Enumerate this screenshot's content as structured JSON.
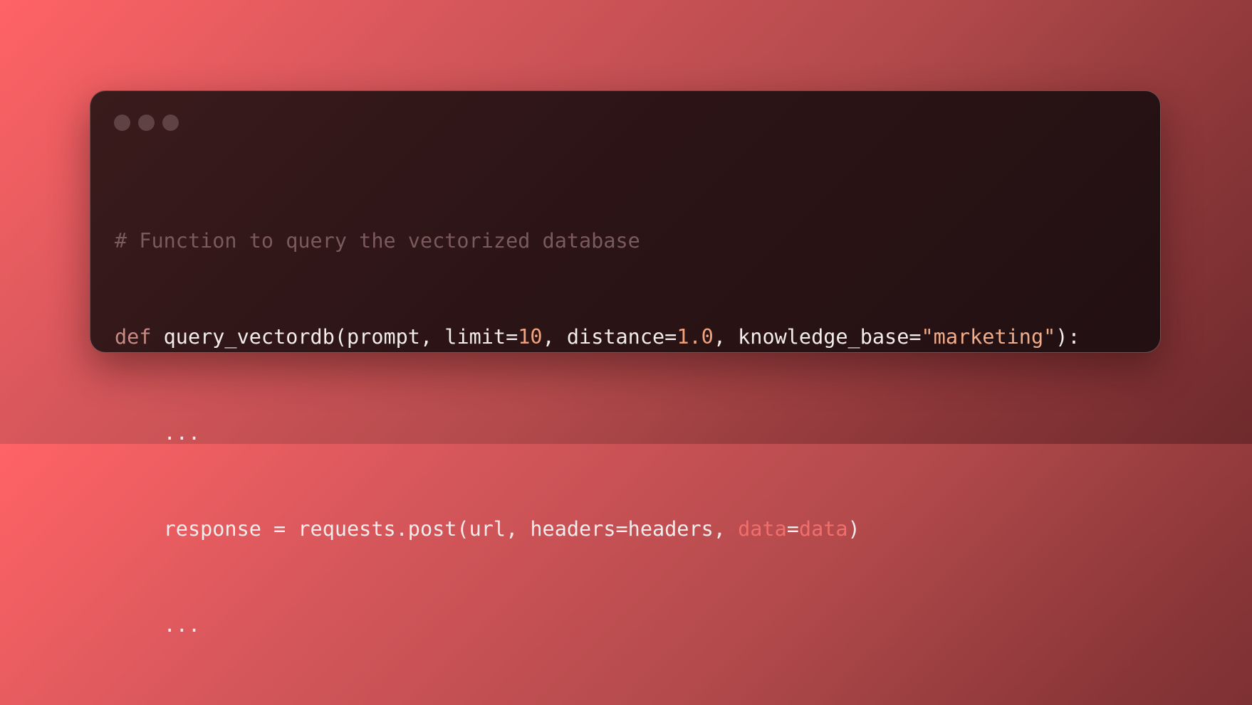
{
  "window": {
    "controls": [
      "close",
      "minimize",
      "maximize"
    ]
  },
  "code": {
    "line1": {
      "comment": "# Function to query the vectorized database"
    },
    "line2": {
      "def": "def",
      "fn_sig_a": " query_vectordb(prompt, limit=",
      "num_limit": "10",
      "sep1": ", distance=",
      "num_distance": "1.0",
      "sep2": ", knowledge_base=",
      "str_kb": "\"marketing\"",
      "end": "):"
    },
    "line3": {
      "text": "    ..."
    },
    "line4": {
      "prefix": "    response = requests.post(url, headers=headers, ",
      "kw_data": "data",
      "equals": "=",
      "val_data": "data",
      "close": ")"
    },
    "line5": {
      "text": "    ..."
    }
  },
  "colors": {
    "background_start": "#ff6366",
    "background_end": "#6e2a2c",
    "window_bg": "#2c1416",
    "comment": "#7a5a5b",
    "keyword": "#c88a84",
    "number": "#f2a37d",
    "string": "#f0ad8c",
    "kwarg": "#f06f6c",
    "text": "#f3ecec"
  }
}
